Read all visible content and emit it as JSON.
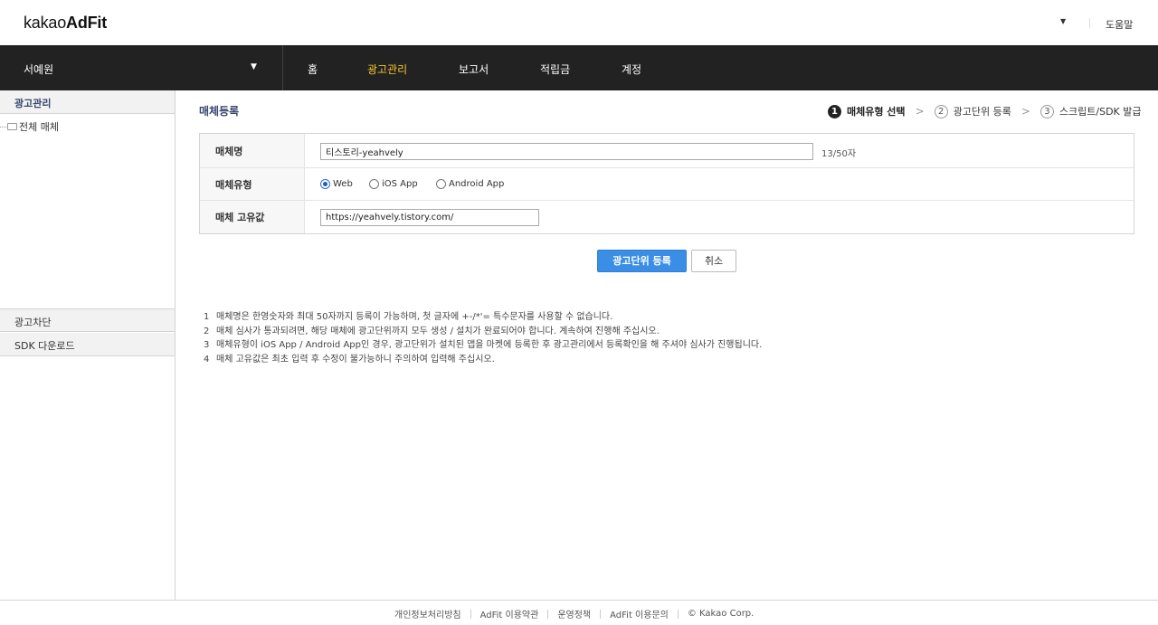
{
  "header": {
    "logo_light": "kakao",
    "logo_bold": "AdFit",
    "caret": "▼",
    "help_label": "도움말"
  },
  "navbar": {
    "account_name": "서예원",
    "account_caret": "▼",
    "items": [
      {
        "label": "홈",
        "active": false
      },
      {
        "label": "광고관리",
        "active": true
      },
      {
        "label": "보고서",
        "active": false
      },
      {
        "label": "적립금",
        "active": false
      },
      {
        "label": "계정",
        "active": false
      }
    ],
    "active_color": "#f6c42c"
  },
  "sidebar": {
    "section1": "광고관리",
    "tree_item": "전체 매체",
    "section2": "광고차단",
    "section3": "SDK 다운로드"
  },
  "main": {
    "title": "매체등록",
    "steps": [
      {
        "num": "1",
        "label": "매체유형 선택",
        "active": true
      },
      {
        "num": "2",
        "label": "광고단위 등록",
        "active": false
      },
      {
        "num": "3",
        "label": "스크립트/SDK 발급",
        "active": false
      }
    ],
    "step_arrow": ">",
    "form": {
      "name_label": "매체명",
      "name_value": "티스토리-yeahvely",
      "name_counter": "13/50자",
      "type_label": "매체유형",
      "type_options": [
        {
          "label": "Web",
          "checked": true
        },
        {
          "label": "iOS App",
          "checked": false
        },
        {
          "label": "Android App",
          "checked": false
        }
      ],
      "unique_label": "매체 고유값",
      "unique_value": "https://yeahvely.tistory.com/"
    },
    "buttons": {
      "register": "광고단위 등록",
      "cancel": "취소"
    },
    "notes": [
      {
        "num": "1",
        "text": "매체명은 한영숫자와 최대 50자까지 등록이 가능하며, 첫 글자에 +-/*'= 특수문자를 사용할 수 없습니다."
      },
      {
        "num": "2",
        "text": "매체 심사가 통과되려면, 해당 매체에 광고단위까지 모두 생성 / 설치가 완료되어야 합니다. 계속하여 진행해 주십시오."
      },
      {
        "num": "3",
        "text": "매체유형이 iOS App / Android App인 경우, 광고단위가 설치된 앱을 마켓에 등록한 후 광고관리에서 등록확인을 해 주셔야 심사가 진행됩니다."
      },
      {
        "num": "4",
        "text": "매체 고유값은 최초 입력 후 수정이 불가능하니 주의하여 입력해 주십시오."
      }
    ]
  },
  "footer": {
    "links": [
      "개인정보처리방침",
      "AdFit 이용약관",
      "운영정책",
      "AdFit 이용문의"
    ],
    "copyright": "© Kakao Corp."
  },
  "colors": {
    "nav_bg": "#222222",
    "accent_blue": "#3a8ee6",
    "title_blue": "#35466d"
  }
}
